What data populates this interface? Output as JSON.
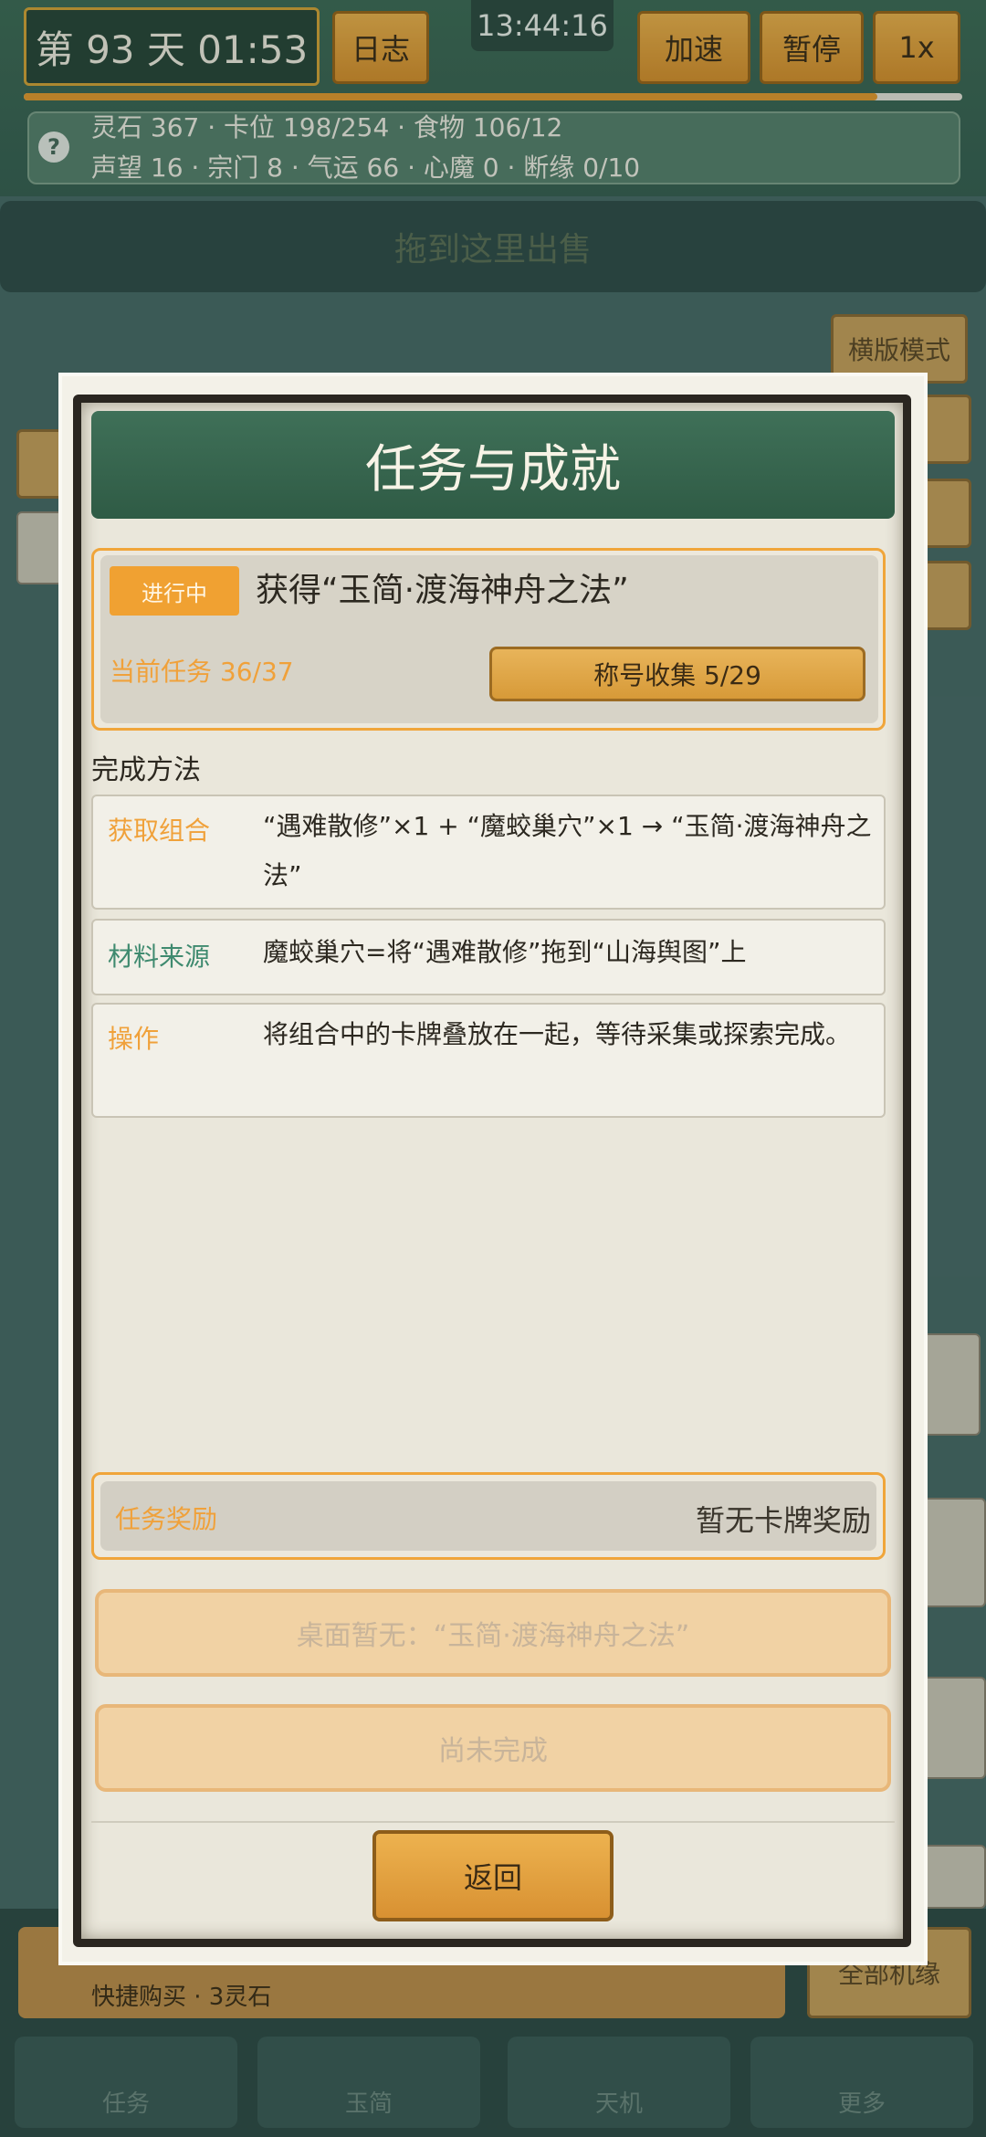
{
  "header": {
    "day": "第 93 天 01:53",
    "log_label": "日志",
    "clock": "13:44:16",
    "speedup_label": "加速",
    "pause_label": "暂停",
    "rate_label": "1x",
    "day_progress": 0.91
  },
  "stats": {
    "line1": "灵石 367 · 卡位 198/254 · 食物 106/12",
    "line2": "声望 16 · 宗门 8 · 气运 66 · 心魔 0 · 断缘 0/10"
  },
  "background": {
    "sell_zone": "拖到这里出售",
    "landscape_mode": "横版模式",
    "quick_buy": "快捷购买 · 3灵石",
    "all_opportunities": "全部机缘",
    "tabs": [
      "任务",
      "玉简",
      "天机",
      "更多"
    ]
  },
  "modal": {
    "title": "任务与成就",
    "status": "进行中",
    "task_title": "获得“玉简·渡海神舟之法”",
    "current_task": "当前任务  36/37",
    "title_collection": "称号收集  5/29",
    "method_heading": "完成方法",
    "methods": [
      {
        "key": "获取组合",
        "value": "“遇难散修”×1 + “魔蛟巢穴”×1 → “玉简·渡海神舟之法”",
        "color": "#f0a13a"
      },
      {
        "key": "材料来源",
        "value": "魔蛟巢穴=将“遇难散修”拖到“山海舆图”上",
        "color": "#3f8a6f"
      },
      {
        "key": "操作",
        "value": "将组合中的卡牌叠放在一起，等待采集或探索完成。",
        "color": "#f0a13a"
      }
    ],
    "reward_label": "任务奖励",
    "reward_value": "暂无卡牌奖励",
    "desk_status": "桌面暂无：“玉简·渡海神舟之法”",
    "complete_status": "尚未完成",
    "back_label": "返回"
  }
}
